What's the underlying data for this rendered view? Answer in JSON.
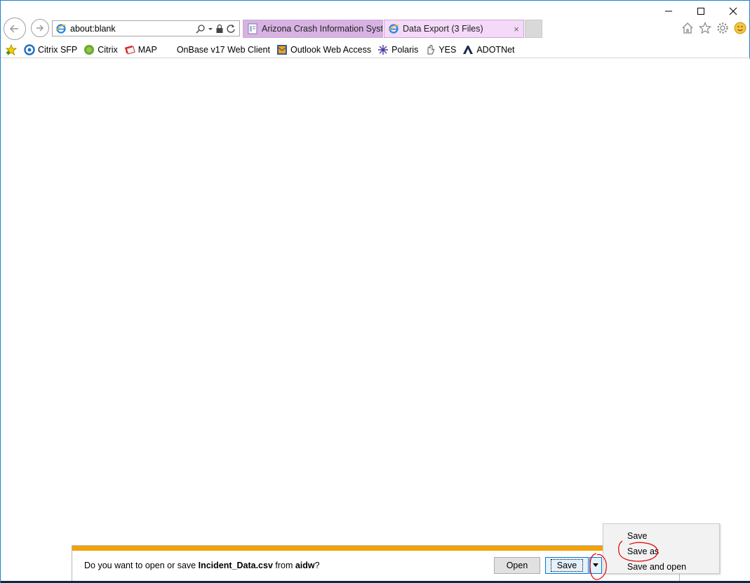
{
  "window": {
    "minimize_icon": "minimize-icon",
    "maximize_icon": "maximize-icon",
    "close_icon": "close-icon"
  },
  "nav": {
    "address_url": "about:blank",
    "back_icon": "back-arrow-icon",
    "forward_icon": "forward-arrow-icon"
  },
  "tabs": [
    {
      "title": "Arizona Crash Information Syst...",
      "icon": "document-icon",
      "active": false
    },
    {
      "title": "Data Export (3 Files)",
      "icon": "ie-icon",
      "active": true,
      "close": "×"
    }
  ],
  "favorites": [
    {
      "label": "Citrix SFP",
      "icon": "citrix-sfp-icon"
    },
    {
      "label": "Citrix",
      "icon": "citrix-icon"
    },
    {
      "label": "MAP",
      "icon": "map-icon"
    },
    {
      "label": "OnBase v17 Web Client",
      "icon": ""
    },
    {
      "label": "Outlook Web Access",
      "icon": "outlook-icon"
    },
    {
      "label": "Polaris",
      "icon": "polaris-icon"
    },
    {
      "label": "YES",
      "icon": "yes-icon"
    },
    {
      "label": "ADOTNet",
      "icon": "adot-icon"
    }
  ],
  "download_bar": {
    "msg_prefix": "Do you want to open or save ",
    "file_name": "Incident_Data.csv",
    "msg_middle": " from ",
    "source": "aidw",
    "msg_suffix": "?",
    "open_label": "Open",
    "save_label": "Save",
    "accent_color": "#f0a30a"
  },
  "save_menu": {
    "items": [
      "Save",
      "Save as",
      "Save and open"
    ]
  },
  "annotation_color": "#e00000"
}
